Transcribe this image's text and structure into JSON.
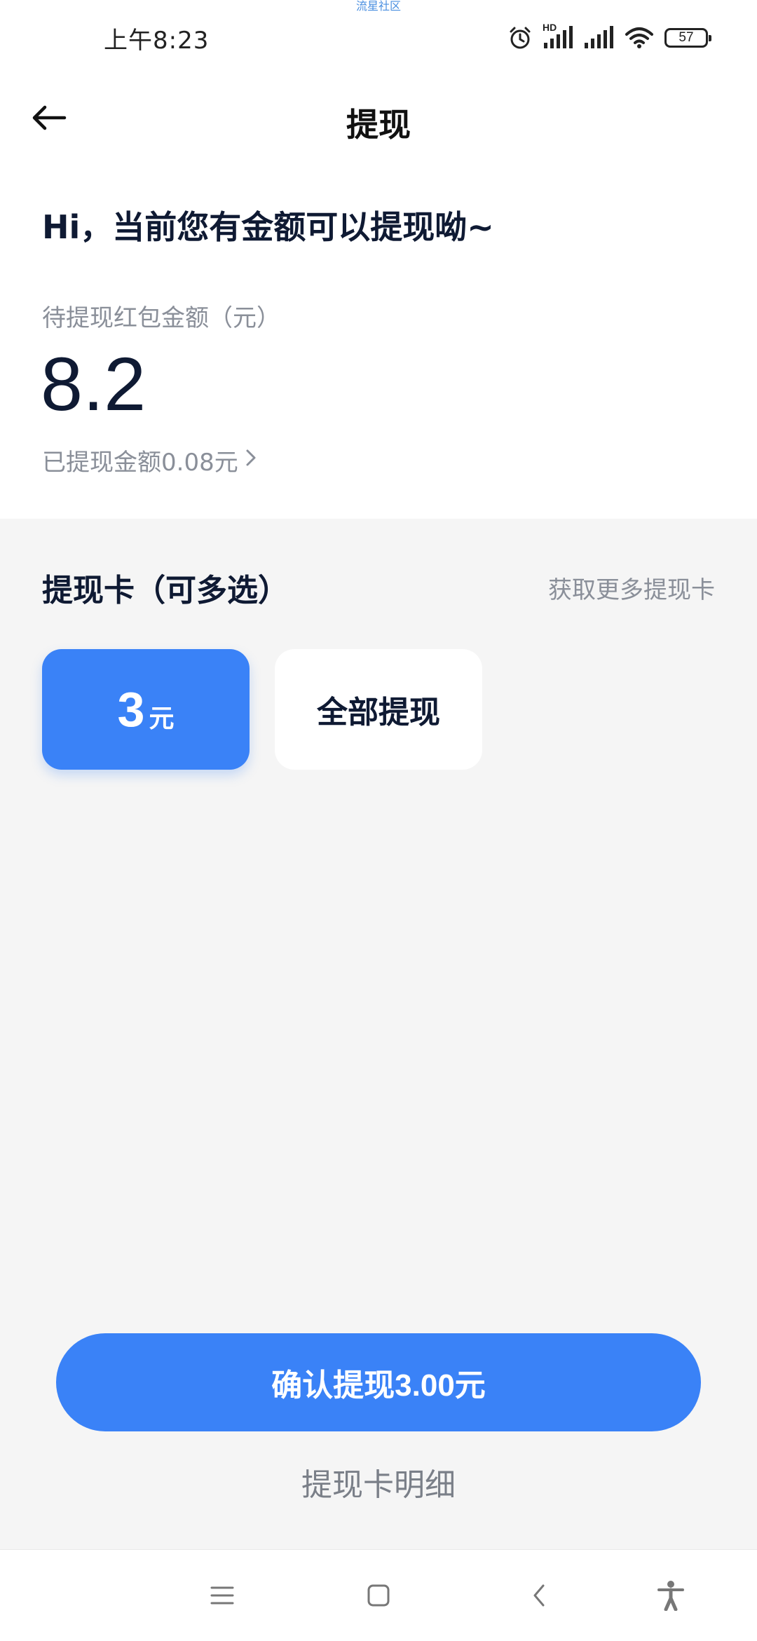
{
  "watermark": "流星社区",
  "status_bar": {
    "time": "上午8:23",
    "network_label": "HD",
    "battery": "57"
  },
  "header": {
    "title": "提现"
  },
  "summary": {
    "greeting": "Hi，当前您有金额可以提现呦~",
    "pending_label": "待提现红包金额（元）",
    "pending_amount": "8.2",
    "withdrawn_text": "已提现金额0.08元"
  },
  "cards_section": {
    "title": "提现卡（可多选）",
    "more_link": "获取更多提现卡",
    "options": [
      {
        "amount": "3",
        "unit": "元",
        "selected": true
      },
      {
        "label": "全部提现",
        "selected": false
      }
    ]
  },
  "actions": {
    "confirm_label": "确认提现3.00元",
    "detail_link": "提现卡明细"
  },
  "colors": {
    "accent": "#3a82f7",
    "background": "#f5f5f5",
    "text_primary": "#0f1a33",
    "text_secondary": "#8a8f99"
  },
  "icons": {
    "back": "arrow-left-icon",
    "alarm": "alarm-icon",
    "signal": "signal-icon",
    "wifi": "wifi-icon",
    "chevron": "chevron-right-icon",
    "menu": "menu-icon",
    "home": "home-icon",
    "back_nav": "back-nav-icon",
    "accessibility": "accessibility-icon"
  }
}
